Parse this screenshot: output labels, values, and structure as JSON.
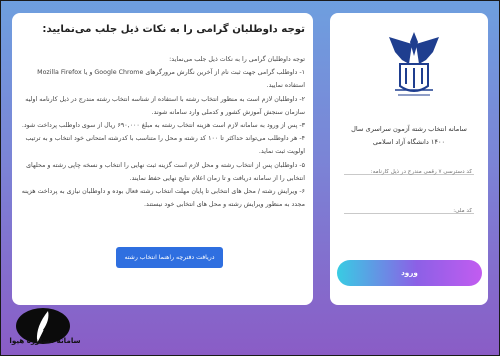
{
  "notice": {
    "title": "توجه داوطلبان گرامی را به نکات ذیل جلب می‌نمایید:",
    "paragraphs": [
      "توجه داوطلبان گرامی را به نکات ذیل جلب می‌نماید:",
      "۱- داوطلب گرامی جهت ثبت نام از آخرین نگارش مرورگرهای Google Chrome و یا Mozilla Firefox استفاده نمایید.",
      "۲- داوطلبان لازم است به منظور انتخاب رشته با استفاده از شناسه انتخاب رشته مندرج در ذیل کارنامه اولیه سازمان سنجش آموزش کشور و کدملی وارد سامانه شوند.",
      "۳- پس از ورود به سامانه لازم است هزینه انتخاب رشته به مبلغ ۶۹۰,۰۰۰ ریال از سوی داوطلب پرداخت شود.",
      "۴- هر داوطلب می‌تواند حداکثر تا ۱۰۰ کد رشته و محل را متناسب با کدرشته امتحانی خود انتخاب و به ترتیب اولویت ثبت نماید.",
      "۵- داوطلبان پس از انتخاب رشته و محل لازم است گزینه ثبت نهایی را انتخاب و نسخه چاپی رشته و محلهای انتخابی را از سامانه دریافت و تا زمان اعلام نتایج نهایی حفظ نمایند.",
      "۶- ویرایش رشته / محل های انتخابی تا پایان مهلت انتخاب رشته فعال بوده و داوطلبان نیازی به پرداخت هزینه مجدد به منظور ویرایش رشته و محل های انتخابی خود نیستند."
    ],
    "download_button": "دریافت دفترچه راهنما انتخاب رشته"
  },
  "login": {
    "title_line1": "سامانه انتخاب رشته آزمون سراسری سال",
    "title_line2": "۱۴۰۰ دانشگاه آزاد اسلامی",
    "tracking_placeholder": "کد دسترسی ۷ رقمی مندرج در ذیل کارنامه:",
    "national_code_placeholder": "کد ملی:",
    "submit_button": "ورود"
  },
  "brand": {
    "name": "سامانه مشاوره هیوا"
  }
}
